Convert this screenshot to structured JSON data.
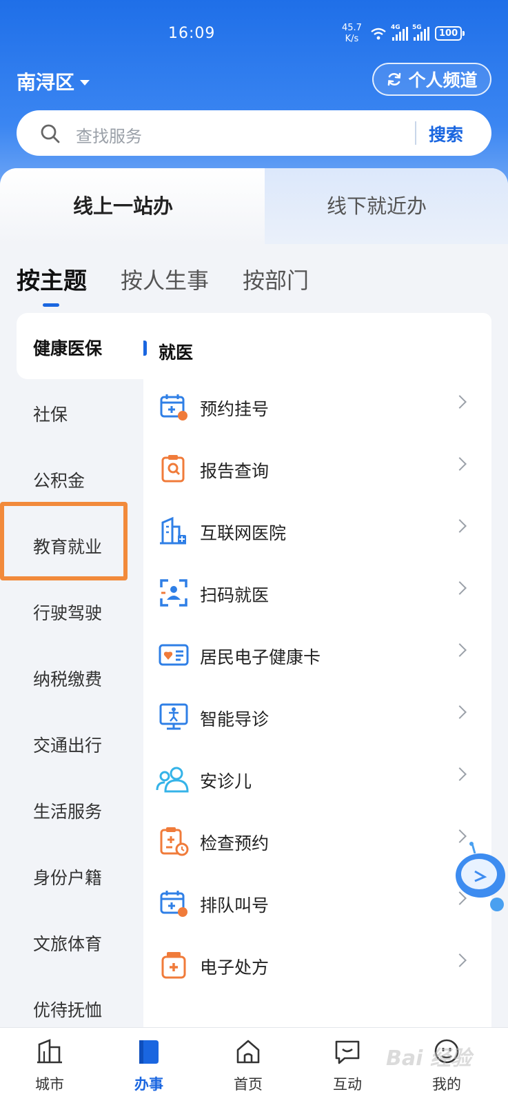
{
  "status_bar": {
    "time": "16:09",
    "speed_value": "45.7",
    "speed_unit": "K/s",
    "net1": "4G",
    "net2": "5G",
    "battery": "100"
  },
  "header": {
    "district": "南浔区",
    "channel_label": "个人频道"
  },
  "search": {
    "placeholder": "查找服务",
    "button": "搜索"
  },
  "service_tabs": [
    {
      "label": "线上一站办",
      "active": true
    },
    {
      "label": "线下就近办",
      "active": false
    }
  ],
  "category_tabs": [
    {
      "label": "按主题",
      "active": true
    },
    {
      "label": "按人生事",
      "active": false
    },
    {
      "label": "按部门",
      "active": false
    }
  ],
  "left_nav": [
    "健康医保",
    "社保",
    "公积金",
    "教育就业",
    "行驶驾驶",
    "纳税缴费",
    "交通出行",
    "生活服务",
    "身份户籍",
    "文旅体育",
    "优待抚恤"
  ],
  "section": {
    "title": "就医"
  },
  "services": [
    {
      "label": "预约挂号",
      "icon": "calendar-plus-icon"
    },
    {
      "label": "报告查询",
      "icon": "report-search-icon"
    },
    {
      "label": "互联网医院",
      "icon": "hospital-building-icon"
    },
    {
      "label": "扫码就医",
      "icon": "scan-person-icon"
    },
    {
      "label": "居民电子健康卡",
      "icon": "health-card-icon"
    },
    {
      "label": "智能导诊",
      "icon": "monitor-guide-icon"
    },
    {
      "label": "安诊儿",
      "icon": "users-icon"
    },
    {
      "label": "检查预约",
      "icon": "clipboard-clock-icon"
    },
    {
      "label": "排队叫号",
      "icon": "calendar-clock-icon"
    },
    {
      "label": "电子处方",
      "icon": "medicine-bottle-icon"
    }
  ],
  "bottom_nav": [
    {
      "label": "城市",
      "active": false
    },
    {
      "label": "办事",
      "active": true
    },
    {
      "label": "首页",
      "active": false
    },
    {
      "label": "互动",
      "active": false
    },
    {
      "label": "我的",
      "active": false
    }
  ],
  "watermark": "Bai 经验",
  "colors": {
    "primary": "#1a66e0",
    "highlight": "#f28a3b",
    "icon_orange": "#f07b3a",
    "icon_blue": "#2f7fe6"
  }
}
